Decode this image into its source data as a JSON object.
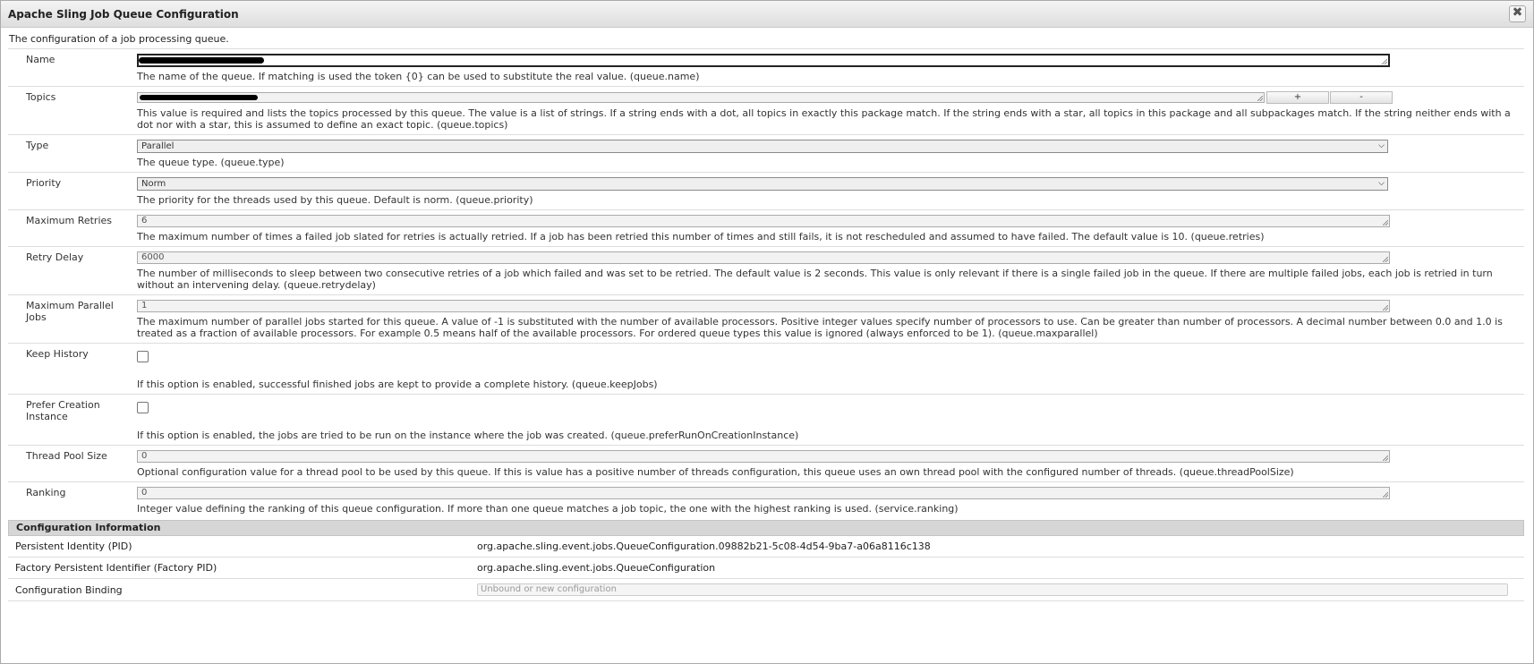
{
  "dialog": {
    "title": "Apache Sling Job Queue Configuration",
    "close_icon": "close-icon",
    "intro": "The configuration of a job processing queue."
  },
  "fields": {
    "name": {
      "label": "Name",
      "value": "",
      "description": "The name of the queue. If matching is used the token {0} can be used to substitute the real value. (queue.name)"
    },
    "topics": {
      "label": "Topics",
      "value": "",
      "add_label": "+",
      "remove_label": "-",
      "description": "This value is required and lists the topics processed by this queue. The value is a list of strings. If a string ends with a dot, all topics in exactly this package match. If the string ends with a star, all topics in this package and all subpackages match. If the string neither ends with a dot nor with a star, this is assumed to define an exact topic. (queue.topics)"
    },
    "type": {
      "label": "Type",
      "value": "Parallel",
      "description": "The queue type. (queue.type)"
    },
    "priority": {
      "label": "Priority",
      "value": "Norm",
      "description": "The priority for the threads used by this queue. Default is norm. (queue.priority)"
    },
    "max_retries": {
      "label": "Maximum Retries",
      "value": "6",
      "description": "The maximum number of times a failed job slated for retries is actually retried. If a job has been retried this number of times and still fails, it is not rescheduled and assumed to have failed. The default value is 10. (queue.retries)"
    },
    "retry_delay": {
      "label": "Retry Delay",
      "value": "6000",
      "description": "The number of milliseconds to sleep between two consecutive retries of a job which failed and was set to be retried. The default value is 2 seconds. This value is only relevant if there is a single failed job in the queue. If there are multiple failed jobs, each job is retried in turn without an intervening delay. (queue.retrydelay)"
    },
    "max_parallel": {
      "label": "Maximum Parallel Jobs",
      "value": "1",
      "description": "The maximum number of parallel jobs started for this queue. A value of -1 is substituted with the number of available processors. Positive integer values specify number of processors to use. Can be greater than number of processors. A decimal number between 0.0 and 1.0 is treated as a fraction of available processors. For example 0.5 means half of the available processors. For ordered queue types this value is ignored (always enforced to be 1). (queue.maxparallel)"
    },
    "keep_history": {
      "label": "Keep History",
      "description": "If this option is enabled, successful finished jobs are kept to provide a complete history. (queue.keepJobs)"
    },
    "prefer_creation": {
      "label": "Prefer Creation Instance",
      "description": "If this option is enabled, the jobs are tried to be run on the instance where the job was created. (queue.preferRunOnCreationInstance)"
    },
    "thread_pool": {
      "label": "Thread Pool Size",
      "value": "0",
      "description": "Optional configuration value for a thread pool to be used by this queue. If this is value has a positive number of threads configuration, this queue uses an own thread pool with the configured number of threads. (queue.threadPoolSize)"
    },
    "ranking": {
      "label": "Ranking",
      "value": "0",
      "description": "Integer value defining the ranking of this queue configuration. If more than one queue matches a job topic, the one with the highest ranking is used. (service.ranking)"
    }
  },
  "config_info": {
    "heading": "Configuration Information",
    "pid_label": "Persistent Identity (PID)",
    "pid_value": "org.apache.sling.event.jobs.QueueConfiguration.09882b21-5c08-4d54-9ba7-a06a8116c138",
    "factory_label": "Factory Persistent Identifier (Factory PID)",
    "factory_value": "org.apache.sling.event.jobs.QueueConfiguration",
    "binding_label": "Configuration Binding",
    "binding_placeholder": "Unbound or new configuration"
  }
}
